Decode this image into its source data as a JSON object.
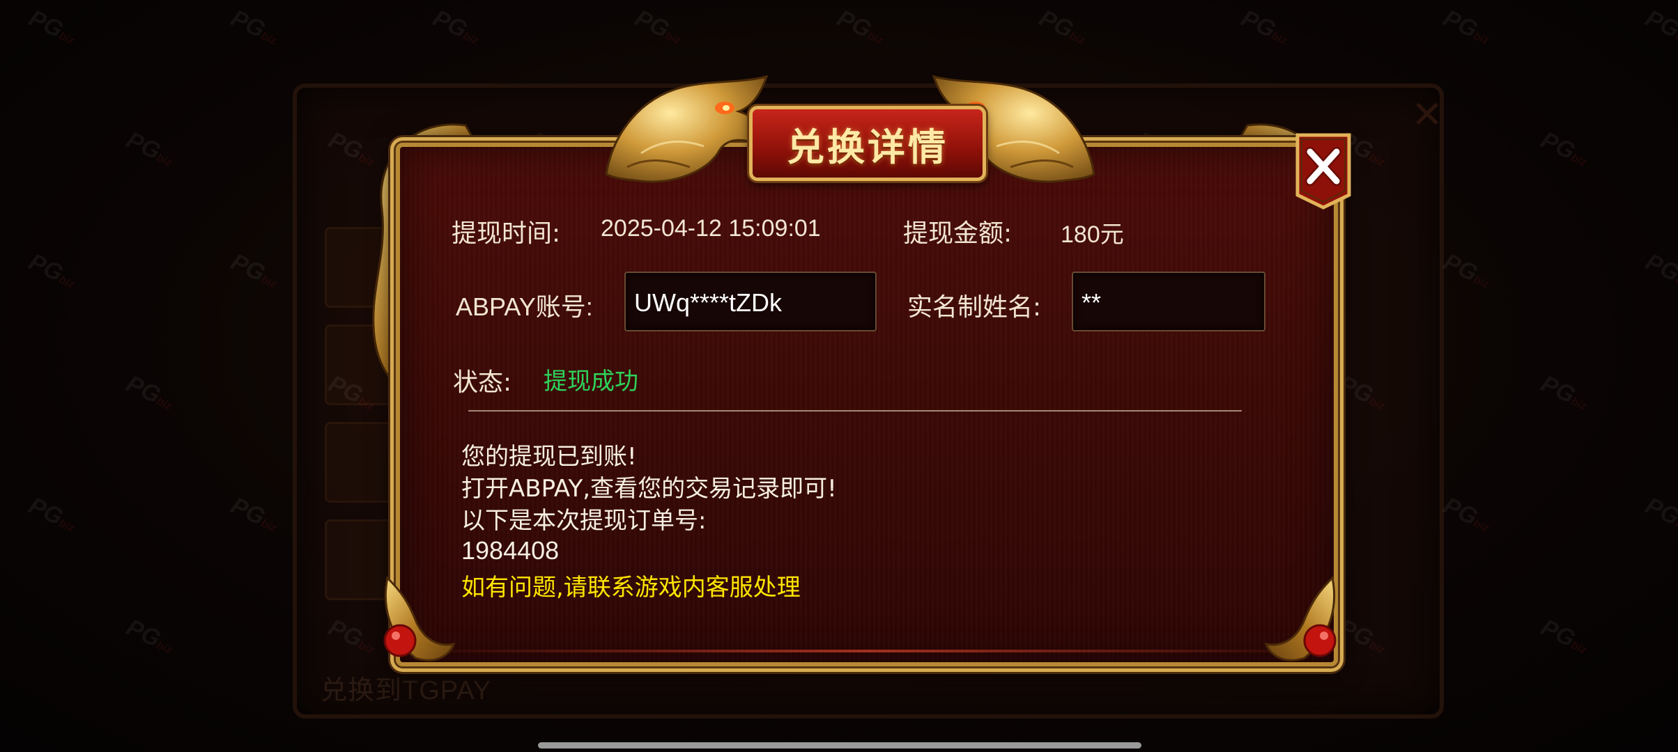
{
  "background": {
    "footer_text": "兑换到TGPAY"
  },
  "dialog": {
    "title": "兑换详情",
    "withdraw_time_label": "提现时间:",
    "withdraw_time_value": "2025-04-12 15:09:01",
    "withdraw_amount_label": "提现金额:",
    "withdraw_amount_value": "180元",
    "account_label": "ABPAY账号:",
    "account_value": "UWq****tZDk",
    "real_name_label": "实名制姓名:",
    "real_name_value": "**",
    "status_label": "状态:",
    "status_value": "提现成功",
    "messages": {
      "line1": "您的提现已到账!",
      "line2": "打开ABPAY,查看您的交易记录即可!",
      "line3": "以下是本次提现订单号:",
      "order_number": "1984408",
      "line5": "如有问题,请联系游戏内客服处理"
    }
  },
  "watermark": {
    "text": "PG",
    "suffix": "biz"
  },
  "icons": {
    "close": "close-icon",
    "dragon": "dragon-ornament-icon"
  },
  "colors": {
    "status_success": "#2ed45a",
    "notice_yellow": "#ffe600",
    "frame_gold": "#d7ab52",
    "panel_red": "#3a0906"
  }
}
